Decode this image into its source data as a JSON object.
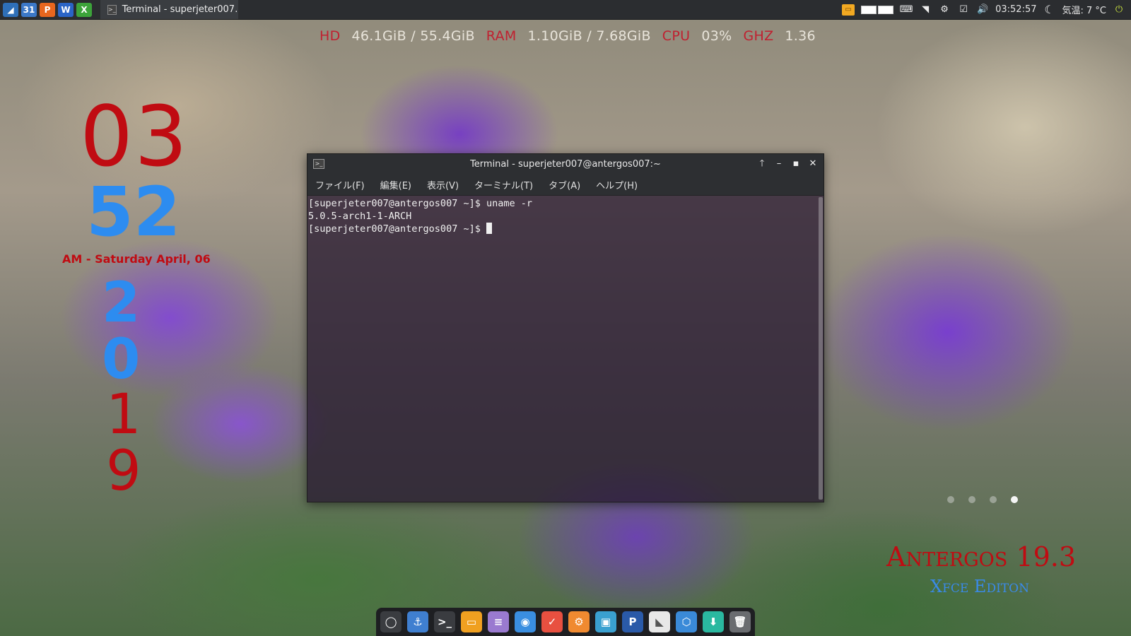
{
  "panel": {
    "launchers": [
      {
        "name": "whisker-menu-icon",
        "glyph": "◢",
        "color": "#2e6fb8"
      },
      {
        "name": "calendar-icon",
        "glyph": "31",
        "color": "#3b78c8"
      },
      {
        "name": "presentation-app-icon",
        "glyph": "P",
        "color": "#e8661e"
      },
      {
        "name": "writer-app-icon",
        "glyph": "W",
        "color": "#2a64c6"
      },
      {
        "name": "spreadsheet-app-icon",
        "glyph": "X",
        "color": "#3ca33a"
      }
    ],
    "task_label": "Terminal - superjeter007…",
    "clock": "03:52:57",
    "weather": "気温: 7 °C"
  },
  "conky": {
    "hd_label": "HD",
    "hd_value": "46.1GiB / 55.4GiB",
    "ram_label": "RAM",
    "ram_value": "1.10GiB / 7.68GiB",
    "cpu_label": "CPU",
    "cpu_value": "03%",
    "ghz_label": "GHZ",
    "ghz_value": "1.36"
  },
  "desktop_clock": {
    "hour": "03",
    "minute": "52",
    "date_line": "AM - Saturday April, 06",
    "year_digits": [
      "2",
      "0",
      "1",
      "9"
    ]
  },
  "branding": {
    "name": "Antergos 19.3",
    "edition": "Xfce Editon"
  },
  "workspace_count": 4,
  "workspace_active": 4,
  "terminal": {
    "title": "Terminal - superjeter007@antergos007:~",
    "menu": [
      "ファイル(F)",
      "編集(E)",
      "表示(V)",
      "ターミナル(T)",
      "タブ(A)",
      "ヘルプ(H)"
    ],
    "lines": [
      "[superjeter007@antergos007 ~]$ uname -r",
      "5.0.5-arch1-1-ARCH",
      "[superjeter007@antergos007 ~]$ "
    ]
  },
  "dock_items": [
    {
      "name": "show-desktop-icon",
      "glyph": "◯",
      "color": "#3a3c40"
    },
    {
      "name": "anchor-icon",
      "glyph": "⚓",
      "color": "#3f7fd0"
    },
    {
      "name": "terminal-icon",
      "glyph": ">_",
      "color": "#3a3c40"
    },
    {
      "name": "file-manager-icon",
      "glyph": "▭",
      "color": "#f0a020"
    },
    {
      "name": "text-editor-icon",
      "glyph": "≡",
      "color": "#9a7ad0"
    },
    {
      "name": "browser-icon",
      "glyph": "◉",
      "color": "#3a8ee0"
    },
    {
      "name": "task-manager-icon",
      "glyph": "✓",
      "color": "#e85040"
    },
    {
      "name": "settings-app-icon",
      "glyph": "⚙",
      "color": "#f08a30"
    },
    {
      "name": "image-viewer-icon",
      "glyph": "▣",
      "color": "#3aa0d0"
    },
    {
      "name": "pdf-app-icon",
      "glyph": "P",
      "color": "#2a5aa8"
    },
    {
      "name": "document-icon",
      "glyph": "◣",
      "color": "#e8e8e8"
    },
    {
      "name": "package-icon",
      "glyph": "⬡",
      "color": "#3a8ad8"
    },
    {
      "name": "update-icon",
      "glyph": "⬇",
      "color": "#2ab8a0"
    },
    {
      "name": "trash-icon",
      "glyph": "🗑",
      "color": "#6a6c70"
    }
  ]
}
